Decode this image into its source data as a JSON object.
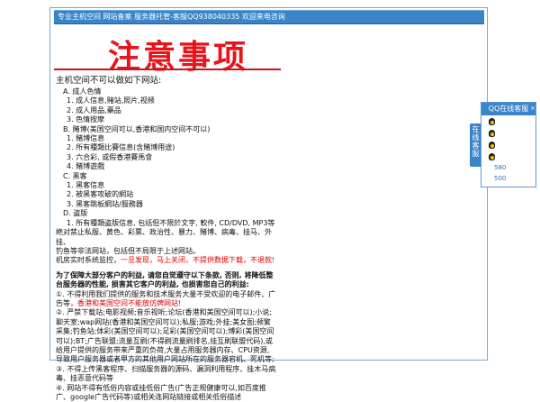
{
  "topbar": {
    "text": "专业主机空间 网站备案 服务器托管-客服QQ938040335 欢迎来电咨询"
  },
  "title": "注意事项",
  "notice": {
    "heading": "主机空间不可以做如下网站:",
    "sections": [
      {
        "label": "A. 成人色情",
        "items": [
          "1. 成人信息,赌站,照片,视频",
          "2. 成人用品,藥品",
          "3. 色情按摩"
        ]
      },
      {
        "label": "B. 賭博(美国空间可以,香港和国内空间不可以)",
        "items": [
          "1. 賭博信息",
          "2. 所有種類比賽信息(含賭博用途)",
          "3. 六合彩, 或假香港賽馬會",
          "4. 賭博遊戲"
        ]
      },
      {
        "label": "C. 黑客",
        "items": [
          "1. 黑客信息",
          "2. 被黑客攻破的網站",
          "3. 黑客跳板網站/服務器"
        ]
      },
      {
        "label": "D. 盗版",
        "items": [
          "1. 所有種類盗版信息, 包括但不限於文字, 軟件, CD/DVD, MP3等"
        ]
      }
    ],
    "extra_lines": [
      "絶对禁止私服、黄色、彩票、政治性、暴力、賭博、病毒、挂马、外挂、",
      "钓鱼等非法网站，包括但不局限于上述网站。"
    ],
    "warning_prefix": "机房实时系统监控，",
    "warning_red": "一旦发现，马上关闭，不提供数据下载，不退款!"
  },
  "protect": {
    "intro": "为了保障大部分客户的利益, 请您自觉遵守以下条款, 否则, 将降低整台服务器的性能, 损害其它客户的利益, 也损害您自己的利益:",
    "p1_a": "①. 不得利用我们提供的服务和技术服务大量不受欢迎的电子邮件、广告等",
    "p1_b": "，香港和美国空间不能放仿牌网站!",
    "p2": "②. 严禁下载站;电影视频;音乐视听;论坛(香港和美国空间可以);小说;聊天室;wap网站(香港和美国空间可以);私服;游戏;外挂;美女图;频繁采集;钓鱼站;体彩(美国空间可以);足彩(美国空间可以);博彩(美国空间可以);BT;广告联盟;流量互刷(不得刷流量刷排名,挂互刷联盟代码),或给用户提供的服务带来严重的负荷,大量占用服务器内存、CPU资源,导致用户服务器或者甲方的其他用户网站所在的服务器宕机、死机等;",
    "p3": "③. 不得上传黑客程序、扫描服务器的源码、漏洞利用程序、挂木马病毒、挂恶意代码等",
    "p4": "④. 网站不得有低俗内容或挂低俗广告(广告正规健康可以,如百度推广、google广告代码等)或相关连网站链接或相关低俗描述"
  },
  "qq_panel": {
    "header": "QQ在线客服",
    "tab": "在线客服",
    "close": "×",
    "numbers": [
      "580",
      "500"
    ]
  }
}
